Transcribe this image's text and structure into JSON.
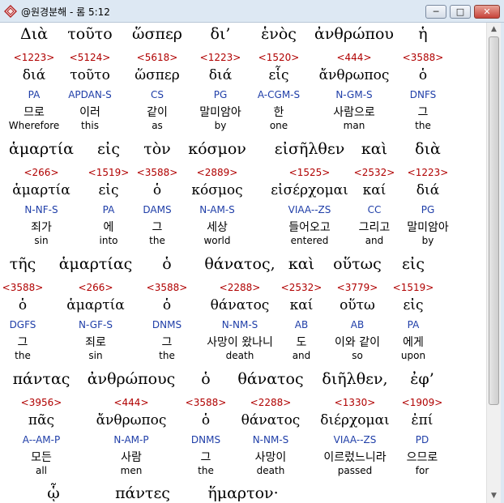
{
  "window": {
    "title": "@원경분해 - 롬 5:12",
    "minimize_glyph": "─",
    "maximize_glyph": "□",
    "close_glyph": "✕"
  },
  "icons": {
    "app": "diamond-app-icon",
    "scroll_up": "▲",
    "scroll_down": "▼"
  },
  "colors": {
    "strong_number": "#b00000",
    "parsing": "#1f3ea8"
  },
  "rows": [
    {
      "words": [
        {
          "greek": "Διὰ",
          "num": "<1223>",
          "lemma": "διά",
          "parse": "PA",
          "korean": "므로",
          "english": "Wherefore"
        },
        {
          "greek": "τοῦτο",
          "num": "<5124>",
          "lemma": "τοῦτο",
          "parse": "APDAN-S",
          "korean": "이러",
          "english": "this"
        },
        {
          "greek": "ὥσπερ",
          "num": "<5618>",
          "lemma": "ὥσπερ",
          "parse": "CS",
          "korean": "같이",
          "english": "as"
        },
        {
          "greek": "δι’",
          "num": "<1223>",
          "lemma": "διά",
          "parse": "PG",
          "korean": "말미암아",
          "english": "by"
        },
        {
          "greek": "ἑνὸς",
          "num": "<1520>",
          "lemma": "εἷς",
          "parse": "A-CGM-S",
          "korean": "한",
          "english": "one"
        },
        {
          "greek": "ἀνθρώπου",
          "num": "<444>",
          "lemma": "ἄνθρωπος",
          "parse": "N-GM-S",
          "korean": "사람으로",
          "english": "man"
        },
        {
          "greek": "ἡ",
          "num": "<3588>",
          "lemma": "ὁ",
          "parse": "DNFS",
          "korean": "그",
          "english": "the"
        }
      ]
    },
    {
      "words": [
        {
          "greek": "ἁμαρτία",
          "num": "<266>",
          "lemma": "ἁμαρτία",
          "parse": "N-NF-S",
          "korean": "죄가",
          "english": "sin"
        },
        {
          "greek": "εἰς",
          "num": "<1519>",
          "lemma": "εἰς",
          "parse": "PA",
          "korean": "에",
          "english": "into"
        },
        {
          "greek": "τὸν",
          "num": "<3588>",
          "lemma": "ὁ",
          "parse": "DAMS",
          "korean": "그",
          "english": "the"
        },
        {
          "greek": "κόσμον",
          "num": "<2889>",
          "lemma": "κόσμος",
          "parse": "N-AM-S",
          "korean": "세상",
          "english": "world"
        },
        {
          "greek": "εἰσῆλθεν",
          "num": "<1525>",
          "lemma": "εἰσέρχομαι",
          "parse": "VIAA--ZS",
          "korean": "들어오고",
          "english": "entered"
        },
        {
          "greek": "καὶ",
          "num": "<2532>",
          "lemma": "καί",
          "parse": "CC",
          "korean": "그리고",
          "english": "and"
        },
        {
          "greek": "διὰ",
          "num": "<1223>",
          "lemma": "διά",
          "parse": "PG",
          "korean": "말미암아",
          "english": "by"
        }
      ]
    },
    {
      "words": [
        {
          "greek": "τῆς",
          "num": "<3588>",
          "lemma": "ὁ",
          "parse": "DGFS",
          "korean": "그",
          "english": "the"
        },
        {
          "greek": "ἁμαρτίας",
          "num": "<266>",
          "lemma": "ἁμαρτία",
          "parse": "N-GF-S",
          "korean": "죄로",
          "english": "sin"
        },
        {
          "greek": "ὁ",
          "num": "<3588>",
          "lemma": "ὁ",
          "parse": "DNMS",
          "korean": "그",
          "english": "the"
        },
        {
          "greek": "θάνατος,",
          "num": "<2288>",
          "lemma": "θάνατος",
          "parse": "N-NM-S",
          "korean": "사망이 왔나니",
          "english": "death"
        },
        {
          "greek": "καὶ",
          "num": "<2532>",
          "lemma": "καί",
          "parse": "AB",
          "korean": "도",
          "english": "and"
        },
        {
          "greek": "οὕτως",
          "num": "<3779>",
          "lemma": "οὕτω",
          "parse": "AB",
          "korean": "이와 같이",
          "english": "so"
        },
        {
          "greek": "εἰς",
          "num": "<1519>",
          "lemma": "εἰς",
          "parse": "PA",
          "korean": "에게",
          "english": "upon"
        }
      ]
    },
    {
      "words": [
        {
          "greek": "πάντας",
          "num": "<3956>",
          "lemma": "πᾶς",
          "parse": "A--AM-P",
          "korean": "모든",
          "english": "all"
        },
        {
          "greek": "ἀνθρώπους",
          "num": "<444>",
          "lemma": "ἄνθρωπος",
          "parse": "N-AM-P",
          "korean": "사람",
          "english": "men"
        },
        {
          "greek": "ὁ",
          "num": "<3588>",
          "lemma": "ὁ",
          "parse": "DNMS",
          "korean": "그",
          "english": "the"
        },
        {
          "greek": "θάνατος",
          "num": "<2288>",
          "lemma": "θάνατος",
          "parse": "N-NM-S",
          "korean": "사망이",
          "english": "death"
        },
        {
          "greek": "διῆλθεν,",
          "num": "<1330>",
          "lemma": "διέρχομαι",
          "parse": "VIAA--ZS",
          "korean": "이르렀느니라",
          "english": "passed"
        },
        {
          "greek": "ἐφ’",
          "num": "<1909>",
          "lemma": "ἐπί",
          "parse": "PD",
          "korean": "으므로",
          "english": "for"
        }
      ]
    },
    {
      "words": [
        {
          "greek": "ᾧ",
          "num": "",
          "lemma": "",
          "parse": "",
          "korean": "",
          "english": ""
        },
        {
          "greek": "πάντες",
          "num": "",
          "lemma": "",
          "parse": "",
          "korean": "",
          "english": ""
        },
        {
          "greek": "ἥμαρτον·",
          "num": "",
          "lemma": "",
          "parse": "",
          "korean": "",
          "english": ""
        }
      ]
    }
  ]
}
